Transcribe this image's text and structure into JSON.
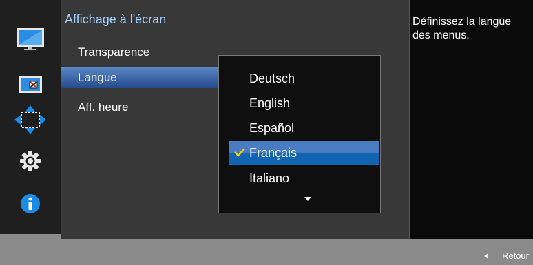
{
  "sidebar": {
    "items": [
      {
        "icon": "display-icon"
      },
      {
        "icon": "picture-size-icon"
      },
      {
        "icon": "position-arrows-icon"
      },
      {
        "icon": "settings-gear-icon"
      },
      {
        "icon": "info-icon"
      }
    ]
  },
  "main": {
    "title": "Affichage à l'écran",
    "items": [
      {
        "label": "Transparence",
        "selected": false
      },
      {
        "label": "Langue",
        "selected": true
      },
      {
        "label": "Aff. heure",
        "selected": false
      }
    ]
  },
  "language_menu": {
    "options": [
      {
        "label": "Deutsch",
        "selected": false
      },
      {
        "label": "English",
        "selected": false
      },
      {
        "label": "Español",
        "selected": false
      },
      {
        "label": "Français",
        "selected": true
      },
      {
        "label": "Italiano",
        "selected": false
      }
    ],
    "more_indicator": "chevron-down-icon"
  },
  "help": {
    "text": "Définissez la langue des menus."
  },
  "footer": {
    "back_label": "Retour",
    "back_icon": "triangle-left-icon"
  },
  "colors": {
    "title": "#9fd0ff",
    "selection_blue": "#1265b2",
    "check_yellow": "#f2d200",
    "info_blue": "#1a8ce8"
  }
}
